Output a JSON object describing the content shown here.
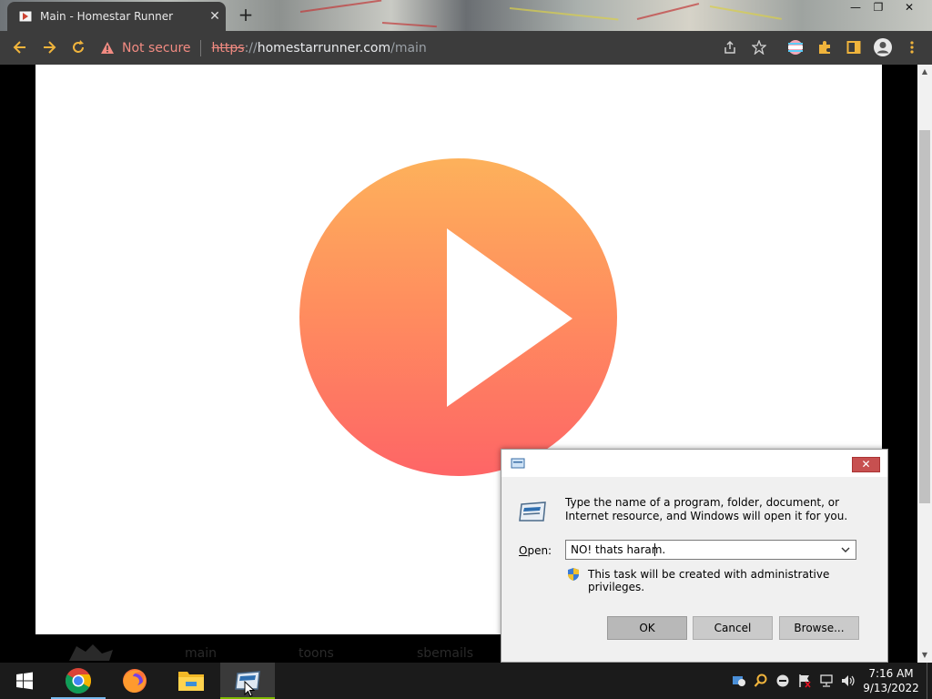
{
  "browser": {
    "tab_title": "Main - Homestar Runner",
    "tab_close": "✕",
    "new_tab": "+",
    "window_controls": {
      "minimize": "—",
      "restore": "❐",
      "close": "✕"
    },
    "security_label": "Not secure",
    "url": {
      "protocol": "https",
      "separator": "://",
      "host": "homestarrunner.com",
      "path": "/main"
    },
    "icons": [
      "back-icon",
      "forward-icon",
      "reload-icon",
      "warning-icon",
      "share-icon",
      "star-icon",
      "profile-flag-icon",
      "extensions-icon",
      "sidepanel-icon",
      "account-icon",
      "menu-icon"
    ]
  },
  "page": {
    "play_button": {
      "colors": {
        "top": "#fdb15b",
        "bottom": "#fe6566"
      }
    },
    "nav_items": [
      "main",
      "toons",
      "sbemails"
    ]
  },
  "run_dialog": {
    "close_label": "✕",
    "description": "Type the name of a program, folder, document, or Internet resource, and Windows will open it for you.",
    "open_label_prefix": "",
    "open_label_mnemonic": "O",
    "open_label_rest": "pen:",
    "open_value": "NO! thats haram.",
    "dropdown_arrow": "⌄",
    "admin_note": "This task will be created with administrative privileges.",
    "ok_label": "OK",
    "cancel_label": "Cancel",
    "browse_label": "Browse..."
  },
  "taskbar": {
    "apps": [
      "start-button",
      "chrome",
      "firefox",
      "file-explorer",
      "run"
    ],
    "time": "7:16 AM",
    "date": "9/13/2022"
  },
  "colors": {
    "chrome_dark": "#3c3c3c",
    "warning": "#f28b82",
    "dialog_bg": "#f0f0f0",
    "taskbar": "#1b1b1b"
  }
}
